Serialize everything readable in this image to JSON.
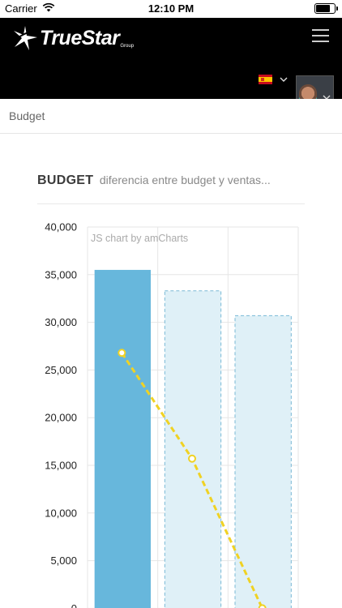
{
  "status_bar": {
    "carrier": "Carrier",
    "time": "12:10 PM",
    "battery_level": 0.8
  },
  "header": {
    "logo_text": "TrueStar",
    "logo_subtext": "Group",
    "language": "es"
  },
  "breadcrumb": {
    "current": "Budget"
  },
  "card": {
    "title": "BUDGET",
    "subtitle": "diferencia entre budget y ventas..."
  },
  "chart_data": {
    "type": "bar",
    "credit": "JS chart by amCharts",
    "categories": [
      "",
      "",
      ""
    ],
    "ylim": [
      0,
      40000
    ],
    "yticks": [
      "40,000",
      "35,000",
      "30,000",
      "25,000",
      "20,000",
      "15,000",
      "10,000",
      "5,000",
      "0"
    ],
    "grid": true,
    "series": [
      {
        "values": [
          35500,
          33300,
          30700
        ],
        "style": [
          "solid",
          "dashed",
          "dashed"
        ],
        "color": "#67b7dc",
        "fill_light": "#dff0f7"
      },
      {
        "type": "line",
        "values": [
          26800,
          15700,
          0
        ],
        "style": "dashed",
        "color": "#f0d223"
      }
    ]
  },
  "colors": {
    "header_bg": "#000000",
    "bar": "#67b7dc",
    "line": "#f0d223"
  }
}
